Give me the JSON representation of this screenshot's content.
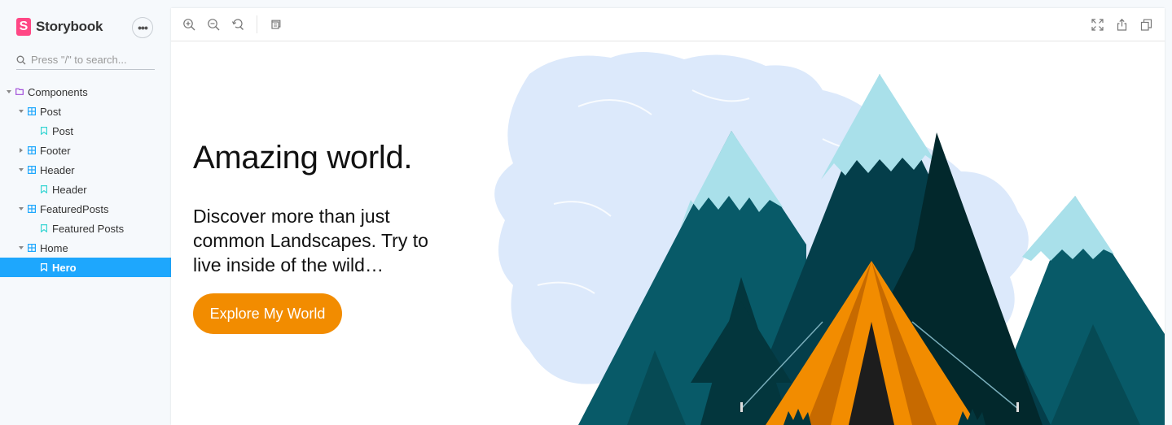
{
  "app": {
    "name": "Storybook",
    "logo_letter": "S"
  },
  "sidebar": {
    "menu_button": "•••",
    "search_placeholder": "Press \"/\" to search...",
    "tree": [
      {
        "label": "Components",
        "type": "folder",
        "expanded": true
      },
      {
        "label": "Post",
        "type": "component",
        "expanded": true
      },
      {
        "label": "Post",
        "type": "story"
      },
      {
        "label": "Footer",
        "type": "component",
        "expanded": false
      },
      {
        "label": "Header",
        "type": "component",
        "expanded": true
      },
      {
        "label": "Header",
        "type": "story"
      },
      {
        "label": "FeaturedPosts",
        "type": "component",
        "expanded": true
      },
      {
        "label": "Featured Posts",
        "type": "story"
      },
      {
        "label": "Home",
        "type": "component",
        "expanded": true
      },
      {
        "label": "Hero",
        "type": "story",
        "selected": true
      }
    ]
  },
  "toolbar": {
    "icons": [
      "zoom-in-icon",
      "zoom-out-icon",
      "zoom-reset-icon",
      "outline-icon",
      "fullscreen-icon",
      "share-icon",
      "copy-icon"
    ]
  },
  "hero": {
    "title": "Amazing world.",
    "subtitle": "Discover more than just common Landscapes. Try to live inside of the wild…",
    "button_label": "Explore My World"
  },
  "colors": {
    "accent": "#1ea7fd",
    "brand": "#ff4785",
    "button": "#f28c00",
    "folder_icon": "#a14cd9",
    "component_icon": "#1ea7fd",
    "story_icon": "#37d5d3"
  }
}
